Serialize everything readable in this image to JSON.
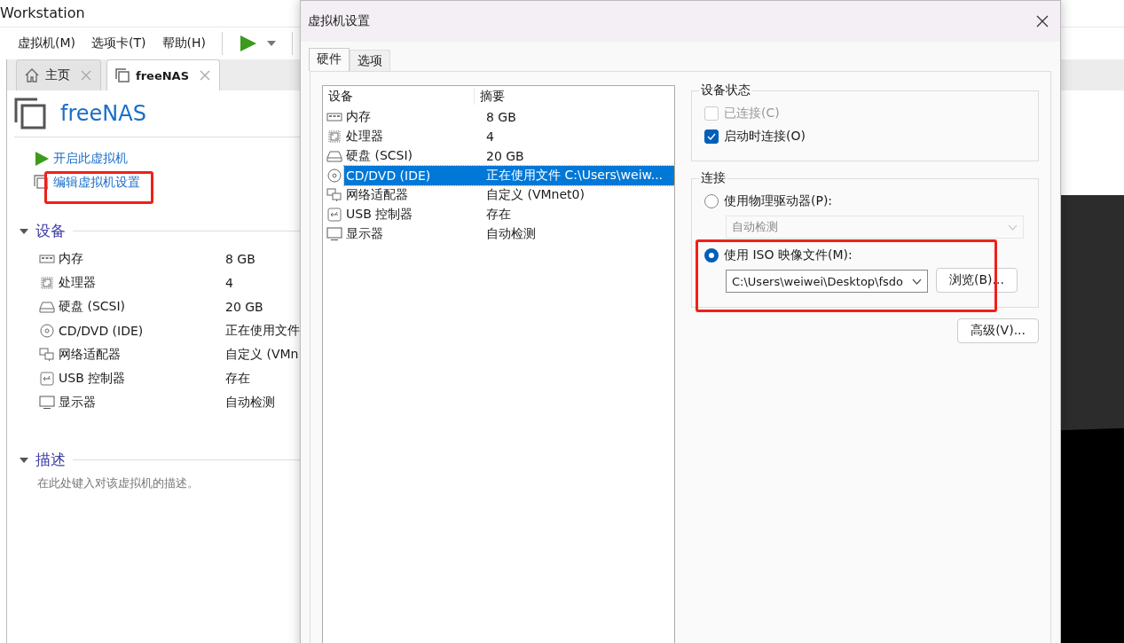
{
  "app": {
    "title": "Workstation",
    "menu": [
      "虚拟机(M)",
      "选项卡(T)",
      "帮助(H)"
    ],
    "tabs": [
      {
        "label": "主页",
        "kind": "home",
        "selected": false
      },
      {
        "label": "freeNAS",
        "kind": "vm",
        "selected": true
      }
    ],
    "vm": {
      "name": "freeNAS",
      "actions": [
        {
          "label": "开启此虚拟机",
          "kind": "power"
        },
        {
          "label": "编辑虚拟机设置",
          "kind": "edit"
        }
      ],
      "devices_heading": "设备",
      "devices": [
        {
          "kind": "memory",
          "name": "内存",
          "summary": "8 GB"
        },
        {
          "kind": "cpu",
          "name": "处理器",
          "summary": "4"
        },
        {
          "kind": "disk",
          "name": "硬盘 (SCSI)",
          "summary": "20 GB"
        },
        {
          "kind": "cd",
          "name": "CD/DVD (IDE)",
          "summary": "正在使用文件"
        },
        {
          "kind": "network",
          "name": "网络适配器",
          "summary": "自定义 (VMn"
        },
        {
          "kind": "usb",
          "name": "USB 控制器",
          "summary": "存在"
        },
        {
          "kind": "display",
          "name": "显示器",
          "summary": "自动检测"
        }
      ],
      "description_heading": "描述",
      "description_placeholder": "在此处键入对该虚拟机的描述。"
    }
  },
  "dialog": {
    "title": "虚拟机设置",
    "tabs": [
      {
        "label": "硬件",
        "selected": true
      },
      {
        "label": "选项",
        "selected": false
      }
    ],
    "table": {
      "columns": [
        "设备",
        "摘要"
      ],
      "rows": [
        {
          "kind": "memory",
          "name": "内存",
          "summary": "8 GB",
          "selected": false
        },
        {
          "kind": "cpu",
          "name": "处理器",
          "summary": "4",
          "selected": false
        },
        {
          "kind": "disk",
          "name": "硬盘 (SCSI)",
          "summary": "20 GB",
          "selected": false
        },
        {
          "kind": "cd",
          "name": "CD/DVD (IDE)",
          "summary": "正在使用文件 C:\\Users\\weiw...",
          "selected": true
        },
        {
          "kind": "network",
          "name": "网络适配器",
          "summary": "自定义 (VMnet0)",
          "selected": false
        },
        {
          "kind": "usb",
          "name": "USB 控制器",
          "summary": "存在",
          "selected": false
        },
        {
          "kind": "display",
          "name": "显示器",
          "summary": "自动检测",
          "selected": false
        }
      ]
    },
    "device_status": {
      "title": "设备状态",
      "options": [
        {
          "label": "已连接(C)",
          "checked": false,
          "disabled": true
        },
        {
          "label": "启动时连接(O)",
          "checked": true,
          "disabled": false
        }
      ]
    },
    "connection": {
      "title": "连接",
      "options": [
        {
          "kind": "drive",
          "label": "使用物理驱动器(P):",
          "selected": false,
          "value": "自动检测"
        },
        {
          "kind": "iso",
          "label": "使用 ISO 映像文件(M):",
          "selected": true,
          "value": "C:\\Users\\weiwei\\Desktop\\fsdo",
          "button": "浏览(B)..."
        }
      ]
    },
    "advanced_button": "高级(V)..."
  }
}
